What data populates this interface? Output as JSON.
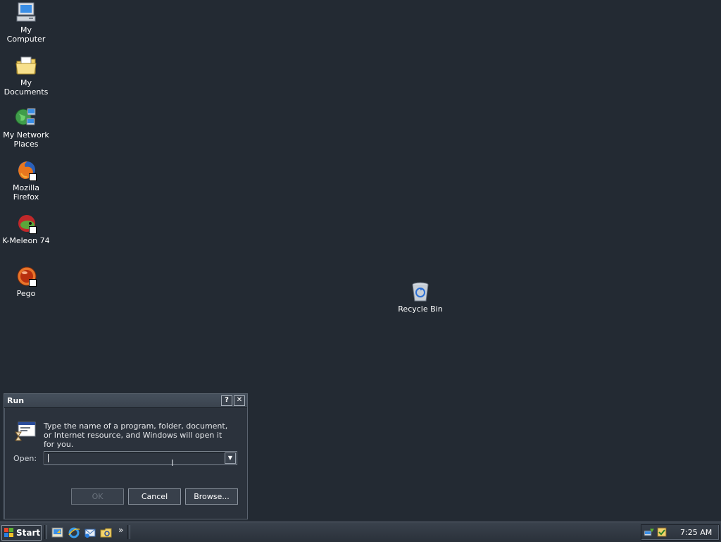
{
  "desktop": {
    "icons": [
      {
        "label": "My Computer",
        "icon": "my-computer-icon"
      },
      {
        "label": "My Documents",
        "icon": "my-documents-icon"
      },
      {
        "label": "My Network Places",
        "icon": "network-places-icon"
      },
      {
        "label": "Mozilla Firefox",
        "icon": "firefox-icon"
      },
      {
        "label": "K-Meleon 74",
        "icon": "k-meleon-icon"
      },
      {
        "label": "Pego",
        "icon": "pego-icon"
      },
      {
        "label": "Recycle Bin",
        "icon": "recycle-bin-icon"
      }
    ]
  },
  "run_dialog": {
    "title": "Run",
    "help_label": "?",
    "close_label": "✕",
    "description": "Type the name of a program, folder, document, or Internet resource, and Windows will open it for you.",
    "open_label": "Open:",
    "open_value": "",
    "ok_label": "OK",
    "cancel_label": "Cancel",
    "browse_label": "Browse..."
  },
  "taskbar": {
    "start_label": "Start",
    "quick_launch": [
      "show-desktop-icon",
      "internet-explorer-icon",
      "outlook-express-icon",
      "windows-explorer-icon"
    ],
    "chevron": "»",
    "clock": "7:25 AM"
  },
  "colors": {
    "desktop_bg": "#232a33",
    "dialog_bg": "#2b323c",
    "taskbar_bg": "#2a313a"
  }
}
